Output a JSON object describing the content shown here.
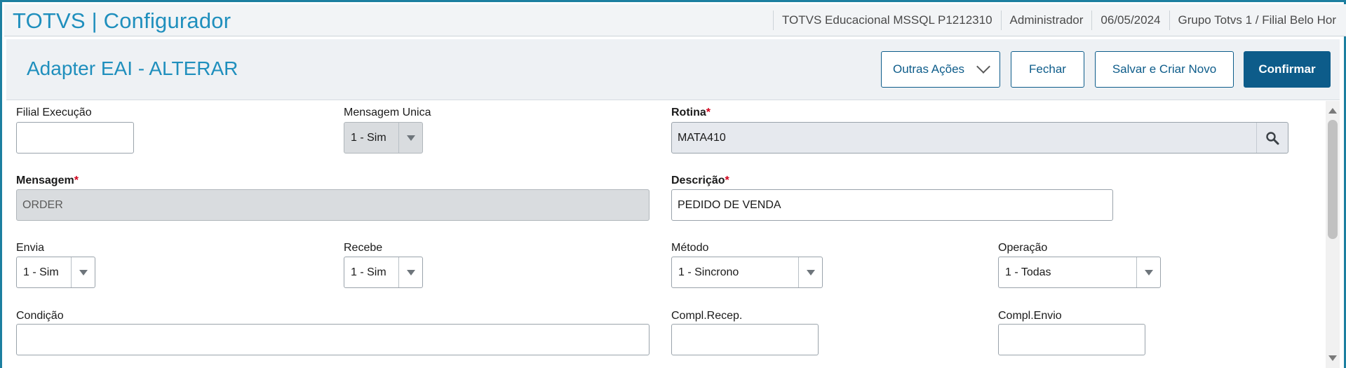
{
  "app": {
    "title": "TOTVS | Configurador"
  },
  "topbar": {
    "environment": "TOTVS Educacional MSSQL P1212310",
    "user": "Administrador",
    "date": "06/05/2024",
    "branch": "Grupo Totvs 1 / Filial Belo Hor"
  },
  "page": {
    "title": "Adapter EAI - ALTERAR"
  },
  "actions": {
    "other": "Outras Ações",
    "close": "Fechar",
    "save_new": "Salvar e Criar Novo",
    "confirm": "Confirmar"
  },
  "form": {
    "filial_execucao": {
      "label": "Filial Execução",
      "value": ""
    },
    "mensagem_unica": {
      "label": "Mensagem Unica",
      "value": "1 - Sim"
    },
    "rotina": {
      "label": "Rotina",
      "value": "MATA410",
      "required": "*"
    },
    "mensagem": {
      "label": "Mensagem",
      "value": "ORDER",
      "required": "*"
    },
    "descricao": {
      "label": "Descrição",
      "value": "PEDIDO DE VENDA",
      "required": "*"
    },
    "envia": {
      "label": "Envia",
      "value": "1 - Sim"
    },
    "recebe": {
      "label": "Recebe",
      "value": "1 - Sim"
    },
    "metodo": {
      "label": "Método",
      "value": "1 - Sincrono"
    },
    "operacao": {
      "label": "Operação",
      "value": "1 - Todas"
    },
    "condicao": {
      "label": "Condição",
      "value": ""
    },
    "compl_recep": {
      "label": "Compl.Recep.",
      "value": ""
    },
    "compl_envio": {
      "label": "Compl.Envio",
      "value": ""
    }
  },
  "icons": {
    "lookup": "search-icon",
    "dropdown": "chevron-down-icon"
  },
  "colors": {
    "brand": "#1f8fbd",
    "primary_button": "#0d5c8a",
    "required": "#d0021b"
  }
}
